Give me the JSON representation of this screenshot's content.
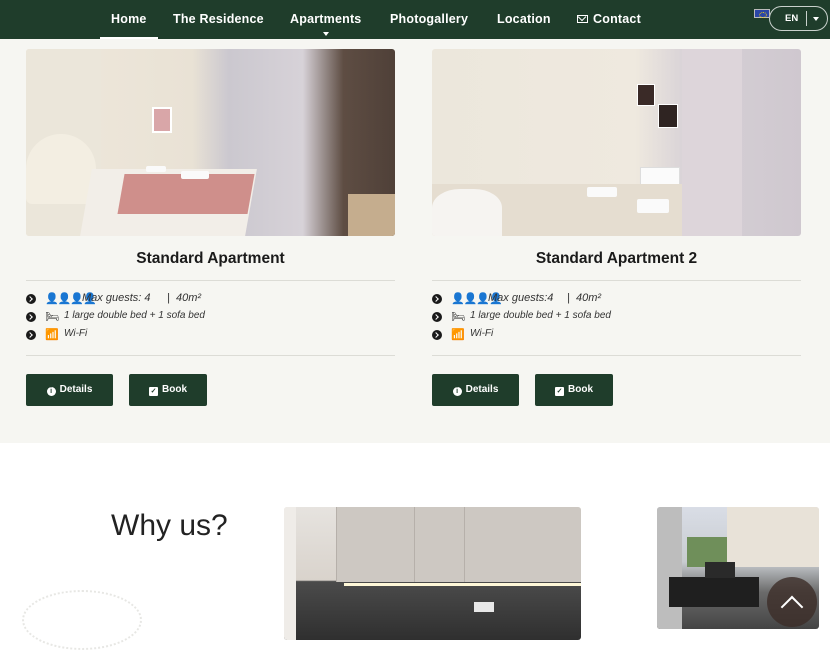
{
  "nav": {
    "items": [
      {
        "label": "Home",
        "active": true
      },
      {
        "label": "The Residence"
      },
      {
        "label": "Apartments",
        "has_dropdown": true
      },
      {
        "label": "Photogallery"
      },
      {
        "label": "Location"
      },
      {
        "label": "Contact",
        "icon": "envelope-icon"
      }
    ],
    "language": "EN"
  },
  "apartments": [
    {
      "title": "Standard Apartment",
      "guests_icon": "people-icon",
      "guests": "Max guests: 4",
      "area_sep": "|",
      "area": "40m²",
      "bed_icon": "bed-icon",
      "beds": "1 large double bed + 1 sofa bed",
      "wifi_icon": "wifi-icon",
      "wifi": "Wi-Fi",
      "details_label": "Details",
      "book_label": "Book"
    },
    {
      "title": "Standard Apartment 2",
      "guests_icon": "people-icon",
      "guests": "Max guests:4",
      "area_sep": "|",
      "area": "40m²",
      "bed_icon": "bed-icon",
      "beds": "1 large double bed + 1 sofa bed",
      "wifi_icon": "wifi-icon",
      "wifi": "Wi-Fi",
      "details_label": "Details",
      "book_label": "Book"
    }
  ],
  "why": {
    "heading": "Why us?"
  },
  "colors": {
    "brand": "#1f3d2b",
    "section_bg": "#f6f6f2"
  }
}
